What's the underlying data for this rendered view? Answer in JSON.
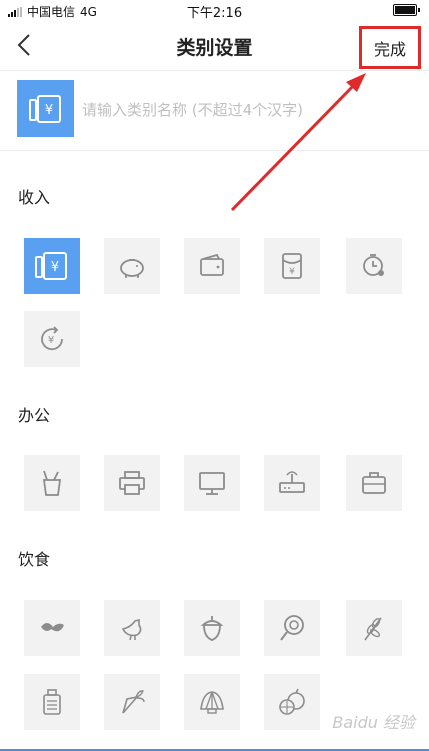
{
  "status_bar": {
    "carrier": "中国电信",
    "network": "4G",
    "time": "下午2:16"
  },
  "header": {
    "title": "类别设置",
    "done_label": "完成"
  },
  "name_field": {
    "placeholder": "请输入类别名称 (不超过4个汉字)",
    "value": ""
  },
  "sections": [
    {
      "title": "收入",
      "icons": [
        "yuan-wallet-icon",
        "piggy-bank-icon",
        "wallet-icon",
        "red-envelope-icon",
        "clock-icon",
        "yuan-refresh-icon"
      ],
      "selected": 0
    },
    {
      "title": "办公",
      "icons": [
        "pencil-cup-icon",
        "printer-icon",
        "monitor-icon",
        "router-icon",
        "briefcase-icon"
      ]
    },
    {
      "title": "饮食",
      "icons": [
        "tea-leaf-icon",
        "chicken-icon",
        "acorn-icon",
        "lollipop-icon",
        "wheat-icon",
        "bottle-icon",
        "carrot-icon",
        "shell-icon",
        "fruit-icon"
      ]
    }
  ],
  "watermark": "Baidu 经验",
  "colors": {
    "accent": "#5aa0f0",
    "annotation": "#e02a2a",
    "icon": "#8c8c8c",
    "tile_bg": "#f2f2f2"
  }
}
